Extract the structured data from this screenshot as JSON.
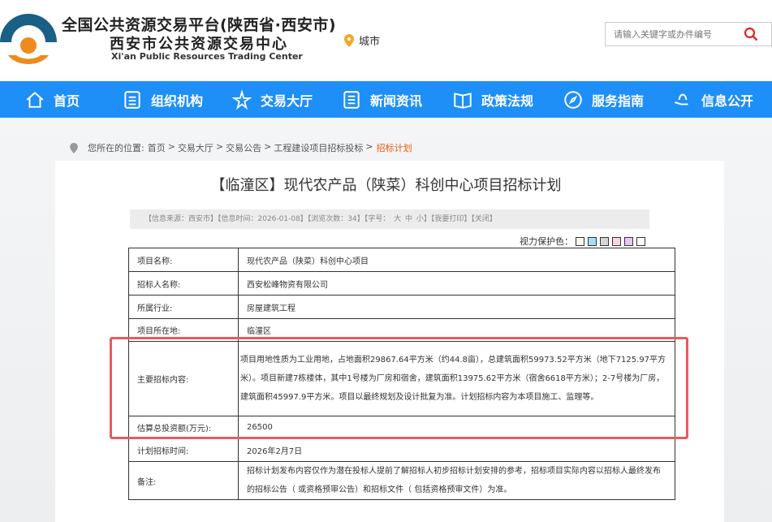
{
  "header": {
    "title_line1": "全国公共资源交易平台(陕西省·西安市)",
    "title_line2": "西安市公共资源交易中心",
    "title_en": "Xi'an Public Resources Trading Center",
    "city": "城市",
    "search_placeholder": "请输入关键字或办件编号"
  },
  "nav": [
    {
      "label": "首页",
      "icon": "home-icon"
    },
    {
      "label": "组织机构",
      "icon": "document-icon"
    },
    {
      "label": "交易大厅",
      "icon": "star-icon"
    },
    {
      "label": "新闻资讯",
      "icon": "list-icon"
    },
    {
      "label": "政策法规",
      "icon": "book-icon"
    },
    {
      "label": "服务指南",
      "icon": "compass-icon"
    },
    {
      "label": "信息公开",
      "icon": "hand-icon"
    }
  ],
  "breadcrumb": {
    "prefix": "您所在的位置:",
    "items": [
      "首页",
      "交易大厅",
      "交易公告",
      "工程建设项目招标投标"
    ],
    "current": "招标计划"
  },
  "article": {
    "title": "【临潼区】现代农产品（陕菜）科创中心项目招标计划",
    "info": "【信息来源：西安市】【信息时间：2026-01-08】【浏览次数：34】【字号： 大 中 小】【我要打印】【关闭】",
    "eye_label": "视力保护色：",
    "eye_colors": [
      "#faf6f0",
      "#a9ddf3",
      "#d6d6d6",
      "#f9d6dd",
      "#e4c8f3",
      "#ffffff"
    ]
  },
  "table": [
    {
      "label": "项目名称:",
      "value": "现代农产品（陕菜）科创中心项目"
    },
    {
      "label": "招标人名称:",
      "value": "西安松峰物资有限公司"
    },
    {
      "label": "所属行业:",
      "value": "房屋建筑工程"
    },
    {
      "label": "项目所在地:",
      "value": "临潼区"
    },
    {
      "label": "主要招标内容:",
      "value": "项目用地性质为工业用地，占地面积29867.64平方米（约44.8亩），总建筑面积59973.52平方米（地下7125.97平方米）。项目新建7栋楼体，其中1号楼为厂房和宿舍，建筑面积13975.62平方米（宿舍6618平方米）；2-7号楼为厂房，建筑面积45997.9平方米。项目以最终规划及设计批复为准。计划招标内容为本项目施工、监理等。"
    },
    {
      "label": "估算总投资额(万元):",
      "value": "26500"
    },
    {
      "label": "计划招标时间:",
      "value": "2026年2月7日"
    },
    {
      "label": "备注:",
      "value": "招标计划发布内容仅作为潜在投标人提前了解招标人初步招标计划安排的参考，招标项目实际内容以招标人最终发布的招标公告（ 或资格预审公告）和招标文件（ 包括资格预审文件）为准。"
    }
  ]
}
